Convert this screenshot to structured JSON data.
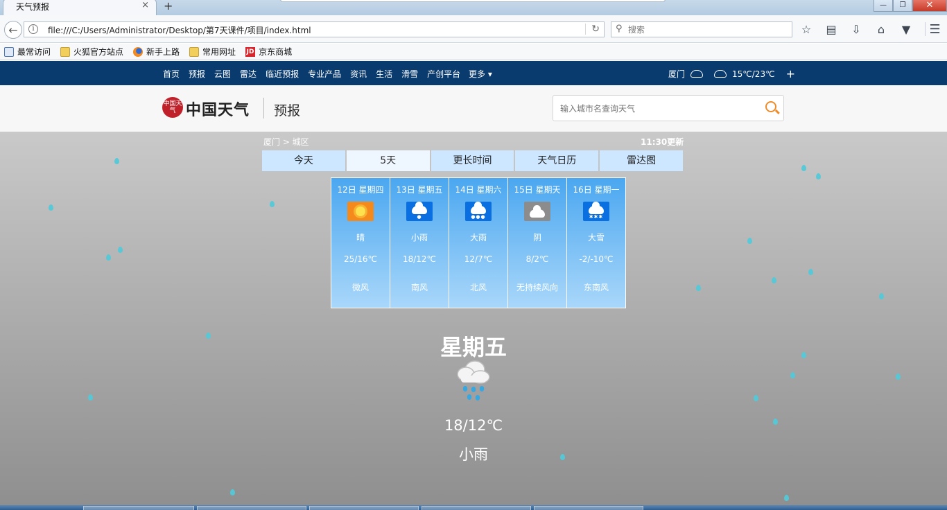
{
  "browser": {
    "tab_title": "天气预报",
    "tab_close": "×",
    "new_tab": "+",
    "url": "file:///C:/Users/Administrator/Desktop/第7天课件/项目/index.html",
    "search_placeholder": "搜索",
    "window_controls": {
      "minimize": "—",
      "restore": "❐",
      "close": "✕"
    },
    "bookmarks": [
      {
        "label": "最常访问",
        "icon": "most-visited-icon"
      },
      {
        "label": "火狐官方站点",
        "icon": "folder-icon"
      },
      {
        "label": "新手上路",
        "icon": "firefox-icon"
      },
      {
        "label": "常用网址",
        "icon": "folder-icon"
      },
      {
        "label": "京东商城",
        "icon": "jd-icon"
      }
    ],
    "toolbar_icons": [
      "star-icon",
      "reading-list-icon",
      "download-icon",
      "home-icon",
      "pocket-icon"
    ]
  },
  "site_nav": {
    "links": [
      "首页",
      "预报",
      "云图",
      "雷达",
      "临近预报",
      "专业产品",
      "资讯",
      "生活",
      "滑雪",
      "产创平台"
    ],
    "more": "更多",
    "city": "厦门",
    "temp_range": "15℃/23℃",
    "add": "+"
  },
  "header": {
    "logo_seal": "中国天气",
    "logo_text": "中国天气",
    "section": "预报",
    "search_placeholder": "输入城市名查询天气"
  },
  "forecast": {
    "breadcrumb": "厦门 > 城区",
    "update_time": "11:30更新",
    "tabs": [
      "今天",
      "5天",
      "更长时间",
      "天气日历",
      "雷达图"
    ],
    "active_tab": "5天",
    "days": [
      {
        "date": "12日 星期四",
        "icon": "sunny-icon",
        "cond": "晴",
        "temp": "25/16℃",
        "wind": "微风"
      },
      {
        "date": "13日 星期五",
        "icon": "light-rain-icon",
        "cond": "小雨",
        "temp": "18/12℃",
        "wind": "南风"
      },
      {
        "date": "14日 星期六",
        "icon": "heavy-rain-icon",
        "cond": "大雨",
        "temp": "12/7℃",
        "wind": "北风"
      },
      {
        "date": "15日 星期天",
        "icon": "overcast-icon",
        "cond": "阴",
        "temp": "8/2℃",
        "wind": "无持续风向"
      },
      {
        "date": "16日 星期一",
        "icon": "heavy-snow-icon",
        "cond": "大雪",
        "temp": "-2/-10℃",
        "wind": "东南风"
      }
    ],
    "selected": {
      "day": "星期五",
      "temp": "18/12℃",
      "cond": "小雨"
    }
  },
  "colors": {
    "site_nav_bg": "#093b6f",
    "tab_bg": "#cce7ff",
    "card_top": "#4aa7f0",
    "card_bottom": "#a9d7fa",
    "raindrop": "#53c9d8",
    "search_accent": "#f08b2a"
  }
}
